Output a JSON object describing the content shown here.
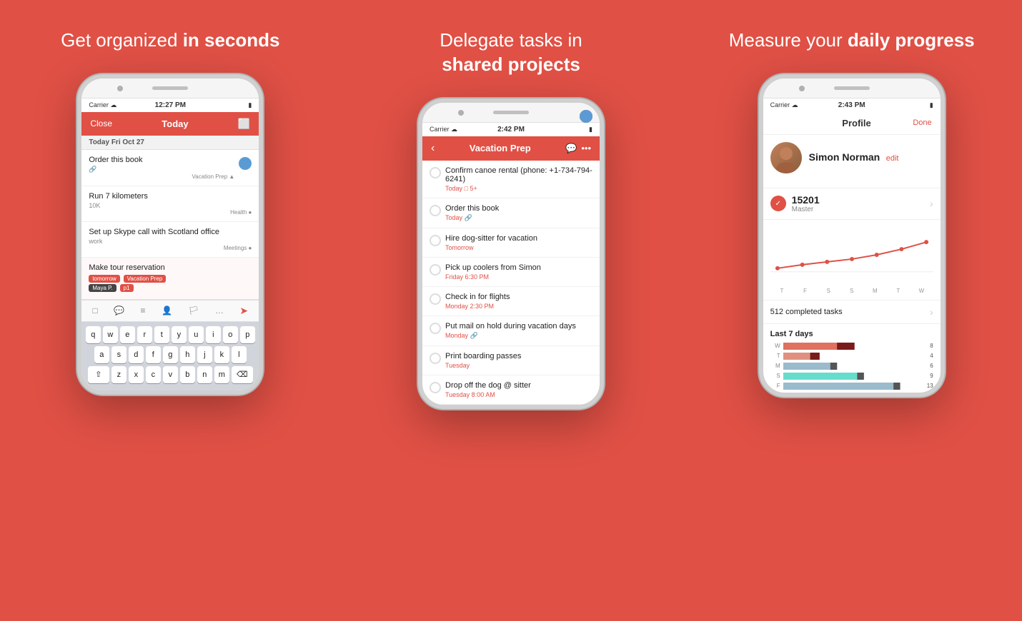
{
  "colors": {
    "accent": "#e05045",
    "white": "#ffffff",
    "lightBg": "#f2f2f2"
  },
  "panels": [
    {
      "title_normal": "Get organized ",
      "title_bold": "in seconds",
      "phone": {
        "status_left": "Carrier ☁",
        "status_time": "12:27 PM",
        "header_close": "Close",
        "header_title": "Today",
        "section_header": "Today  Fri Oct 27",
        "tasks": [
          {
            "title": "Order this book",
            "sub": "",
            "tag": "Vacation Prep ▲",
            "has_avatar": true,
            "avatar_color": "blue"
          },
          {
            "title": "Run 7 kilometers",
            "sub": "10K",
            "tag": "Health ●",
            "has_avatar": false
          },
          {
            "title": "Set up Skype call with Scotland office",
            "sub": "work",
            "tag": "Meetings ●",
            "has_avatar": false
          }
        ],
        "editing_task": "Make tour reservation",
        "editing_tags": [
          "tomorrow",
          "Vacation Prep"
        ],
        "editing_sub_tags": [
          "Maya P.",
          "p1"
        ],
        "keyboard_rows": [
          [
            "q",
            "w",
            "e",
            "r",
            "t",
            "y",
            "u",
            "i",
            "o",
            "p"
          ],
          [
            "a",
            "s",
            "d",
            "f",
            "g",
            "h",
            "j",
            "k",
            "l"
          ],
          [
            "⇧",
            "z",
            "x",
            "c",
            "v",
            "b",
            "n",
            "m",
            "⌫"
          ]
        ]
      }
    },
    {
      "title_normal": "Delegate tasks in ",
      "title_bold": "shared projects",
      "phone": {
        "status_left": "Carrier ☁",
        "status_time": "2:42 PM",
        "header_title": "Vacation Prep",
        "tasks": [
          {
            "title": "Confirm canoe rental (phone: +1-734-794-6241)",
            "sub": "Today  □ 5+",
            "sub_red": true,
            "has_avatar": true
          },
          {
            "title": "Order this book",
            "sub": "Today  🔗",
            "sub_red": true,
            "has_avatar": true
          },
          {
            "title": "Hire dog-sitter for vacation",
            "sub": "Tomorrow",
            "sub_red": true,
            "has_avatar": true
          },
          {
            "title": "Pick up coolers from Simon",
            "sub": "Friday 6:30 PM",
            "sub_red": true,
            "has_avatar": true
          },
          {
            "title": "Check in for flights",
            "sub": "Monday 2:30 PM",
            "sub_red": true,
            "has_avatar": false
          },
          {
            "title": "Put mail on hold during vacation days",
            "sub": "Monday  🔗",
            "sub_red": true,
            "has_avatar": false
          },
          {
            "title": "Print boarding passes",
            "sub": "Tuesday",
            "sub_red": true,
            "has_avatar": false
          },
          {
            "title": "Drop off the dog @ sitter",
            "sub": "Tuesday 8:00 AM",
            "sub_red": true,
            "has_avatar": false
          }
        ]
      }
    },
    {
      "title_normal": "Measure your ",
      "title_bold": "daily progress",
      "phone": {
        "status_left": "Carrier ☁",
        "status_time": "2:43 PM",
        "header_title": "Profile",
        "header_done": "Done",
        "profile_name": "Simon Norman",
        "profile_edit": "edit",
        "karma_score": "15201",
        "karma_level": "Master",
        "chart_labels": [
          "T",
          "F",
          "S",
          "S",
          "M",
          "T",
          "W"
        ],
        "completed_text": "512 completed tasks",
        "last7_title": "Last 7 days",
        "bars": [
          {
            "label": "W",
            "value": 8,
            "max": 15,
            "color": "#e05045",
            "color2": "#555"
          },
          {
            "label": "T",
            "value": 4,
            "max": 15,
            "color": "#e07060",
            "color2": "#555"
          },
          {
            "label": "M",
            "value": 6,
            "max": 15,
            "color": "#9bc",
            "color2": "#555"
          },
          {
            "label": "S",
            "value": 9,
            "max": 15,
            "color": "#6dc",
            "color2": "#555"
          },
          {
            "label": "F",
            "value": 13,
            "max": 15,
            "color": "#9bc",
            "color2": "#555"
          }
        ],
        "bar_values": [
          "W · 8",
          "T · 4",
          "M · 6",
          "S · 9",
          "F · 13"
        ]
      }
    }
  ]
}
